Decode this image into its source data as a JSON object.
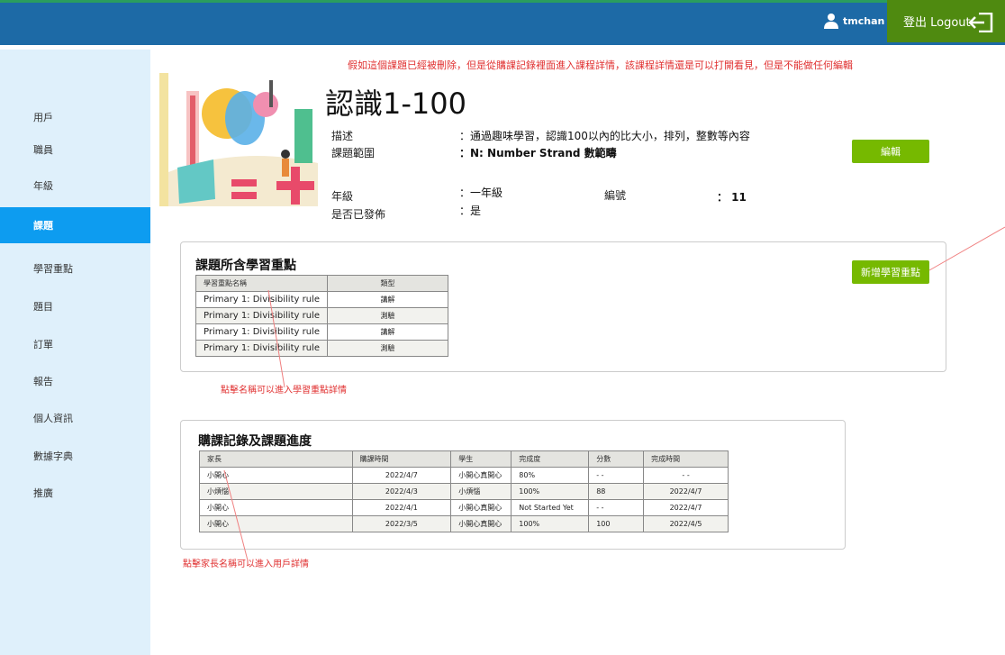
{
  "header": {
    "username": "tmchan",
    "logout_label": "登出 Logout",
    "colors": {
      "bar": "#1d6aa6",
      "logout": "#4f8a10"
    }
  },
  "sidebar": {
    "items": [
      {
        "label": "用戶"
      },
      {
        "label": "職員"
      },
      {
        "label": "年級"
      },
      {
        "label": "課題"
      },
      {
        "label": "學習重點"
      },
      {
        "label": "題目"
      },
      {
        "label": "訂單"
      },
      {
        "label": "報告"
      },
      {
        "label": "個人資訊"
      },
      {
        "label": "數據字典"
      },
      {
        "label": "推廣"
      }
    ],
    "active": "課題"
  },
  "notes": {
    "top": "假如這個課題已經被刪除，但是從購課記錄裡面進入課程詳情，該課程詳情還是可以打開看見，但是不能做任何編輯",
    "topic_points": "點擊名稱可以進入學習重點詳情",
    "parent": "點擊家長名稱可以進入用戶詳情"
  },
  "course": {
    "title": "認識1-100",
    "desc_label": "描述",
    "desc_value": "：通過趣味學習，認識100以內的比大小，排列，整數等內容",
    "scope_label": "課題範圍",
    "scope_value": "：N: Number Strand 數範疇",
    "grade_label": "年級",
    "grade_value": "：一年級",
    "id_label": "編號",
    "id_value": "：  11",
    "published_label": "是否已發佈",
    "published_value": "：是",
    "edit_label": "編輯"
  },
  "points": {
    "title": "課題所含學習重點",
    "add_label": "新增學習重點",
    "headers": [
      "學習重點名稱",
      "類型"
    ],
    "rows": [
      [
        "Primary 1: Divisibility rule",
        "講解"
      ],
      [
        "Primary 1: Divisibility rule",
        "測驗"
      ],
      [
        "Primary 1: Divisibility rule",
        "講解"
      ],
      [
        "Primary 1: Divisibility rule",
        "測驗"
      ]
    ]
  },
  "purchases": {
    "title": "購課記錄及課題進度",
    "headers": [
      "家長",
      "購課時間",
      "學生",
      "完成度",
      "分數",
      "完成時間"
    ],
    "rows": [
      [
        "小開心",
        "2022/4/7",
        "小開心真開心",
        "80%",
        "- -",
        "- -"
      ],
      [
        "小煩惱",
        "2022/4/3",
        "小煩惱",
        "100%",
        "88",
        "2022/4/7"
      ],
      [
        "小開心",
        "2022/4/1",
        "小開心真開心",
        "Not Started Yet",
        "- -",
        "2022/4/7"
      ],
      [
        "小開心",
        "2022/3/5",
        "小開心真開心",
        "100%",
        "100",
        "2022/4/5"
      ]
    ]
  }
}
